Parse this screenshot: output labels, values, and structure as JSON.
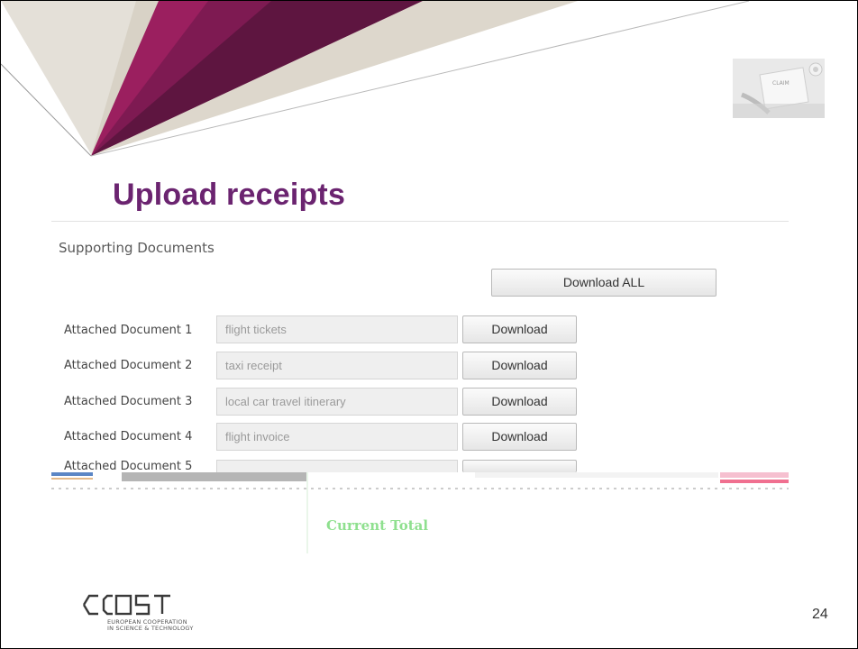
{
  "slide": {
    "title": "Upload receipts",
    "page_number": "24"
  },
  "photo": {
    "claim_text": "CLAIM"
  },
  "supporting_documents": {
    "heading": "Supporting Documents",
    "download_all_label": "Download ALL",
    "rows": [
      {
        "label": "Attached Document 1",
        "value": "flight tickets",
        "button": "Download"
      },
      {
        "label": "Attached Document 2",
        "value": "taxi receipt",
        "button": "Download"
      },
      {
        "label": "Attached Document 3",
        "value": "local car travel itinerary",
        "button": "Download"
      },
      {
        "label": "Attached Document 4",
        "value": "flight invoice",
        "button": "Download"
      },
      {
        "label": "Attached Document 5",
        "value": "",
        "button": ""
      }
    ],
    "current_total_label": "Current Total"
  },
  "logo": {
    "line1": "EUROPEAN COOPERATION",
    "line2": "IN SCIENCE & TECHNOLOGY"
  },
  "colors": {
    "title": "#6b2470",
    "magenta": "#9b1f5f",
    "grey_band": "#d6d0c4"
  }
}
